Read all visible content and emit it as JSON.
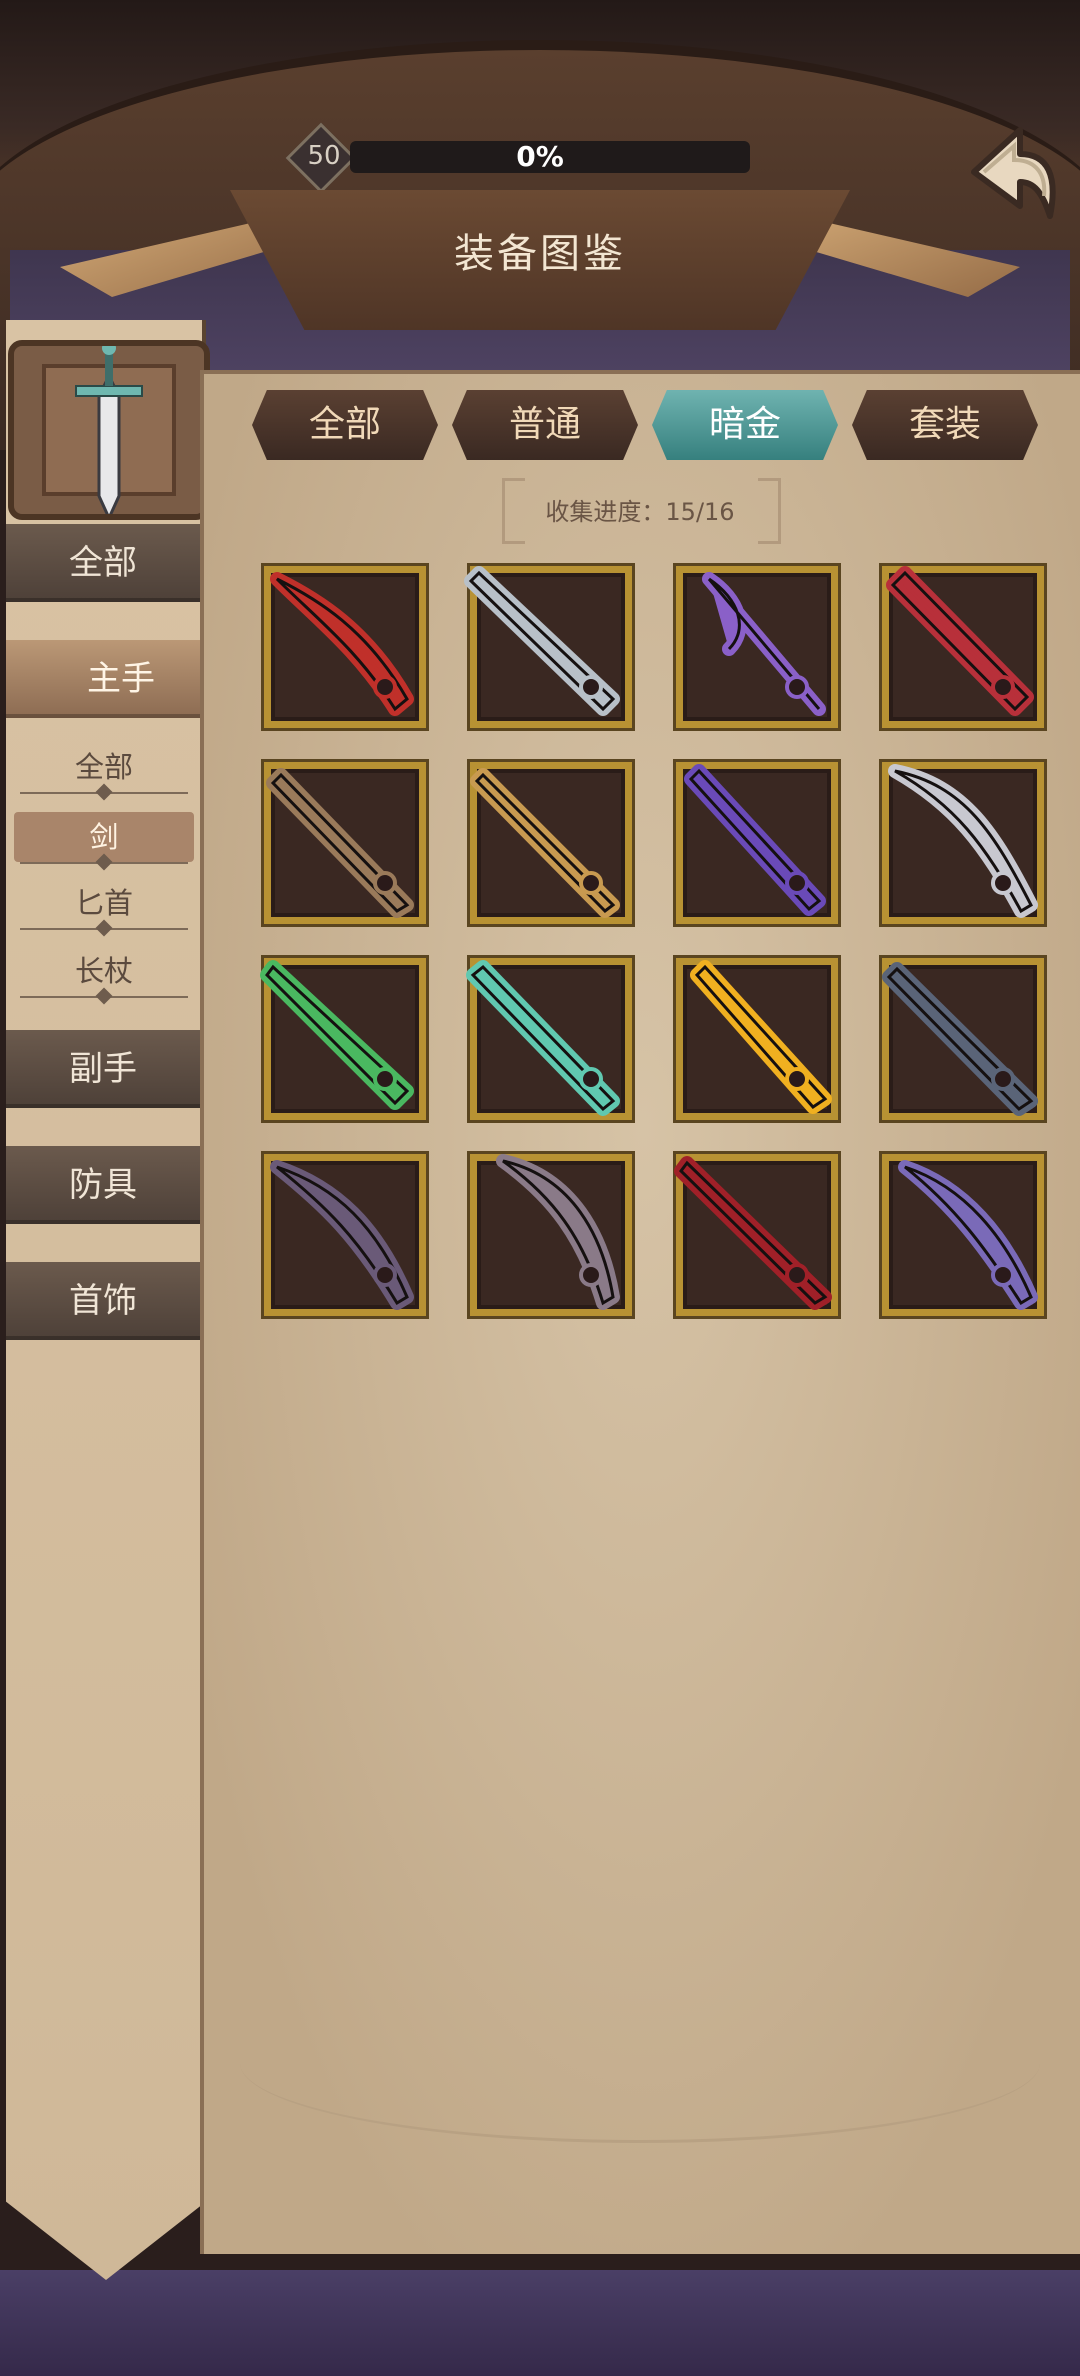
{
  "header": {
    "level": "50",
    "progress_text": "0%",
    "title": "装备图鉴"
  },
  "tabs": [
    {
      "label": "全部",
      "active": false
    },
    {
      "label": "普通",
      "active": false
    },
    {
      "label": "暗金",
      "active": true
    },
    {
      "label": "套装",
      "active": false
    }
  ],
  "collection": {
    "label": "收集进度：15/16"
  },
  "sidebar": {
    "categories": [
      {
        "label": "全部",
        "active": false
      },
      {
        "label": "主手",
        "active": true
      },
      {
        "label": "副手",
        "active": false
      },
      {
        "label": "防具",
        "active": false
      },
      {
        "label": "首饰",
        "active": false
      }
    ],
    "subcategories": [
      {
        "label": "全部",
        "active": false
      },
      {
        "label": "剑",
        "active": true
      },
      {
        "label": "匕首",
        "active": false
      },
      {
        "label": "长杖",
        "active": false
      }
    ]
  },
  "items": [
    {
      "icon": "red-curved-blade-icon",
      "color": "#c0302a"
    },
    {
      "icon": "steel-longsword-icon",
      "color": "#b8c0c8"
    },
    {
      "icon": "purple-skull-axe-icon",
      "color": "#8a60c8"
    },
    {
      "icon": "crimson-sword-icon",
      "color": "#b8303a"
    },
    {
      "icon": "dark-spider-sword-icon",
      "color": "#9a7a5a"
    },
    {
      "icon": "bronze-sun-sword-icon",
      "color": "#c89a50"
    },
    {
      "icon": "violet-winged-sword-icon",
      "color": "#6a4ab8"
    },
    {
      "icon": "silver-scimitar-icon",
      "color": "#c8c8d0"
    },
    {
      "icon": "green-crystal-sword-icon",
      "color": "#4ab860"
    },
    {
      "icon": "teal-lightning-sword-icon",
      "color": "#60c8b0"
    },
    {
      "icon": "golden-flame-blade-icon",
      "color": "#f0b020"
    },
    {
      "icon": "obsidian-greatsword-icon",
      "color": "#5a6478"
    },
    {
      "icon": "shadow-cleaver-icon",
      "color": "#6a5a78"
    },
    {
      "icon": "grey-serrated-blade-icon",
      "color": "#8a7a88"
    },
    {
      "icon": "blood-thorn-sword-icon",
      "color": "#a02028"
    },
    {
      "icon": "dusk-bone-blade-icon",
      "color": "#7a6ab8"
    }
  ]
}
